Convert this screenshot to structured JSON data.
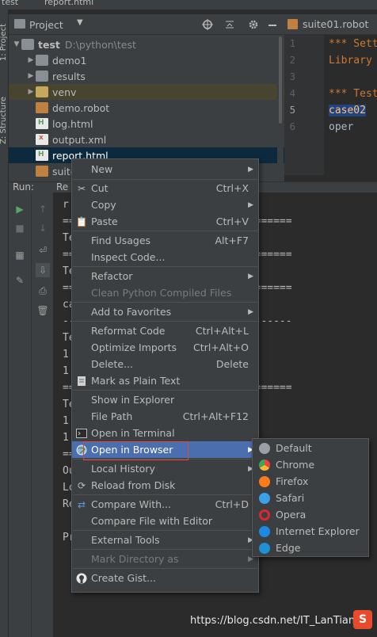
{
  "titlebar": {
    "project": "test",
    "file": "report.html"
  },
  "left_strip": {
    "tab_project": "1: Project",
    "tab_structure": "Z: Structure"
  },
  "project_panel": {
    "title": "Project"
  },
  "tree": {
    "root": {
      "label": "test",
      "path": "D:\\python\\test"
    },
    "items": [
      {
        "label": "demo1"
      },
      {
        "label": "results"
      },
      {
        "label": "venv"
      },
      {
        "label": "demo.robot"
      },
      {
        "label": "log.html"
      },
      {
        "label": "output.xml"
      },
      {
        "label": "report.html"
      },
      {
        "label": "suite"
      }
    ]
  },
  "editor": {
    "tab": "suite01.robot",
    "line_numbers": [
      "1",
      "2",
      "3",
      "4",
      "5",
      "6"
    ],
    "lines": [
      "*** Sett",
      "Library",
      "",
      "*** Test",
      "case02",
      "    oper"
    ]
  },
  "run": {
    "label": "Run:",
    "tab": "Re"
  },
  "console": {
    "lines": [
      "r",
      "=====================================",
      "Te",
      "=====================================",
      "Te",
      "=====================================",
      "ca",
      "-------------------------------------",
      "Te",
      "1                          iled",
      "1                          d",
      "=====================================",
      "Te",
      "1                          iled",
      "1                          d",
      "=====================================",
      "Ou",
      "Lo",
      "Re",
      "",
      "Pr"
    ]
  },
  "context_menu": {
    "items": [
      {
        "label": "New",
        "has_sub": true
      },
      {
        "label": "Cut",
        "shortcut": "Ctrl+X",
        "icon": "scissors-icon"
      },
      {
        "label": "Copy",
        "has_sub": true
      },
      {
        "label": "Paste",
        "shortcut": "Ctrl+V",
        "icon": "clipboard-icon"
      },
      {
        "label": "Find Usages",
        "shortcut": "Alt+F7"
      },
      {
        "label": "Inspect Code..."
      },
      {
        "label": "Refactor",
        "has_sub": true
      },
      {
        "label": "Clean Python Compiled Files",
        "disabled": true
      },
      {
        "label": "Add to Favorites",
        "has_sub": true
      },
      {
        "label": "Reformat Code",
        "shortcut": "Ctrl+Alt+L"
      },
      {
        "label": "Optimize Imports",
        "shortcut": "Ctrl+Alt+O"
      },
      {
        "label": "Delete...",
        "shortcut": "Delete"
      },
      {
        "label": "Mark as Plain Text",
        "icon": "text-file-icon"
      },
      {
        "label": "Show in Explorer"
      },
      {
        "label": "File Path",
        "shortcut": "Ctrl+Alt+F12"
      },
      {
        "label": "Open in Terminal",
        "icon": "terminal-icon"
      },
      {
        "label": "Open in Browser",
        "has_sub": true,
        "highlighted": true,
        "icon": "globe-icon"
      },
      {
        "label": "Local History",
        "has_sub": true
      },
      {
        "label": "Reload from Disk",
        "icon": "reload-icon"
      },
      {
        "label": "Compare With...",
        "shortcut": "Ctrl+D",
        "icon": "compare-icon"
      },
      {
        "label": "Compare File with Editor"
      },
      {
        "label": "External Tools",
        "has_sub": true
      },
      {
        "label": "Mark Directory as",
        "has_sub": true,
        "disabled": true
      },
      {
        "label": "Create Gist...",
        "icon": "github-icon"
      }
    ]
  },
  "browser_submenu": {
    "items": [
      {
        "label": "Default",
        "color": "#9aa0a6"
      },
      {
        "label": "Chrome",
        "color": "#e8453c"
      },
      {
        "label": "Firefox",
        "color": "#ff7a1a"
      },
      {
        "label": "Safari",
        "color": "#3aa0e8"
      },
      {
        "label": "Opera",
        "color": "#e0262c"
      },
      {
        "label": "Internet Explorer",
        "color": "#1e88e5"
      },
      {
        "label": "Edge",
        "color": "#1f8fd6"
      }
    ]
  },
  "watermark": {
    "text": "https://blog.csdn.net/IT_LanTian",
    "logo": "S"
  }
}
